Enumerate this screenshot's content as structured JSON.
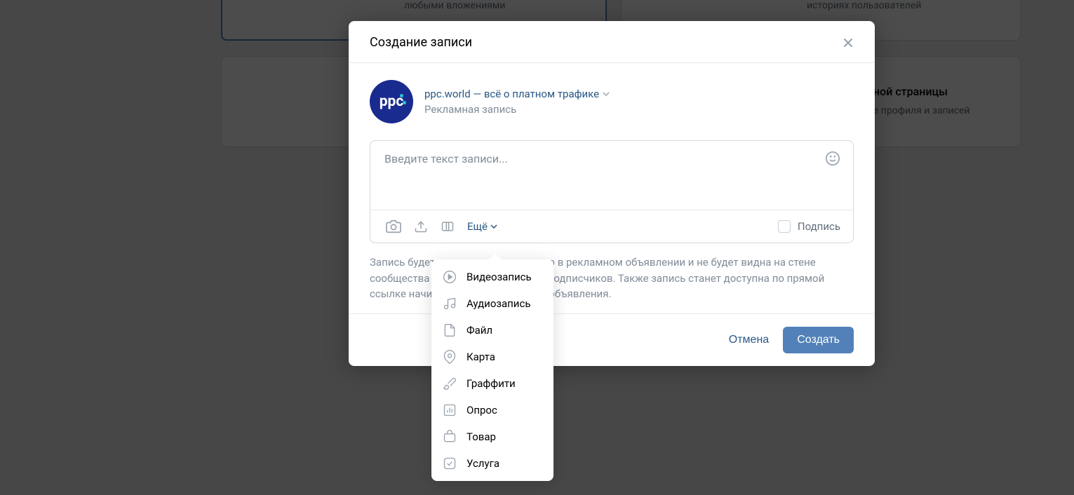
{
  "background": {
    "text1": "любыми вложениями",
    "text2": "историях пользователей",
    "title3": "ной страницы",
    "text3": "е профиля и записей"
  },
  "modal": {
    "title": "Создание записи",
    "author": {
      "name": "ppc.world — всё о платном трафике",
      "subtitle": "Рекламная запись",
      "avatar_text": "ppc"
    },
    "editor": {
      "placeholder": "Введите текст записи...",
      "more_label": "Ещё",
      "signature_label": "Подпись"
    },
    "info_text": "Запись будет использоваться только в рекламном объявлении и не будет видна на стене сообщества или в новостной ленте подписчиков. Также запись станет доступна по прямой ссылке начиная с момента запуска объявления.",
    "footer": {
      "cancel": "Отмена",
      "create": "Создать"
    }
  },
  "dropdown": {
    "items": [
      {
        "label": "Видеозапись",
        "icon": "video"
      },
      {
        "label": "Аудиозапись",
        "icon": "audio"
      },
      {
        "label": "Файл",
        "icon": "file"
      },
      {
        "label": "Карта",
        "icon": "map"
      },
      {
        "label": "Граффити",
        "icon": "graffiti"
      },
      {
        "label": "Опрос",
        "icon": "poll"
      },
      {
        "label": "Товар",
        "icon": "product"
      },
      {
        "label": "Услуга",
        "icon": "service"
      }
    ]
  }
}
